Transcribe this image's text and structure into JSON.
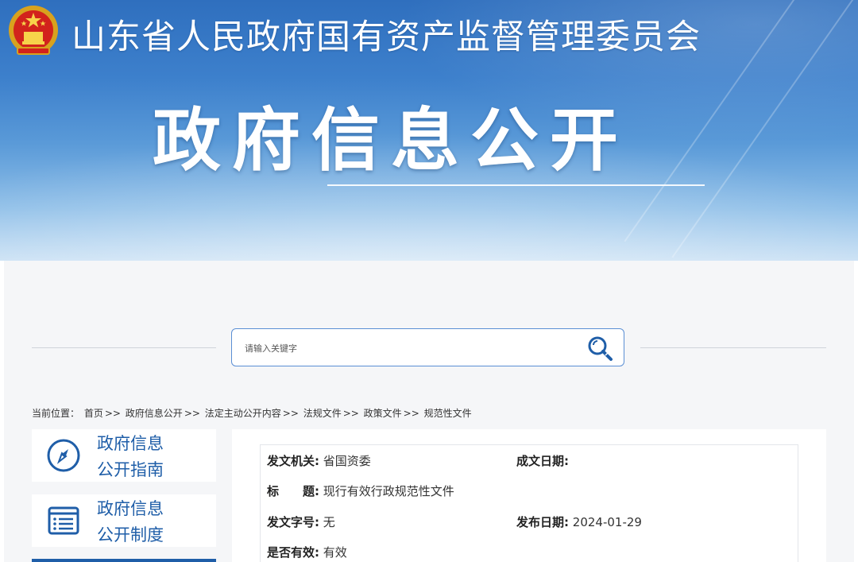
{
  "header": {
    "site_title": "山东省人民政府国有资产监督管理委员会",
    "page_heading": "政府信息公开"
  },
  "search": {
    "placeholder": "请输入关键字"
  },
  "breadcrumb": {
    "prefix": "当前位置：",
    "items": [
      "首页",
      "政府信息公开",
      "法定主动公开内容",
      "法规文件",
      "政策文件",
      "规范性文件"
    ],
    "separator": ">>"
  },
  "sidebar": {
    "items": [
      {
        "line1": "政府信息",
        "line2": "公开指南"
      },
      {
        "line1": "政府信息",
        "line2": "公开制度"
      }
    ]
  },
  "document_meta": {
    "issuer_label": "发文机关:",
    "issuer_value": "省国资委",
    "created_label": "成文日期:",
    "created_value": "",
    "title_label": "标　　题:",
    "title_value": "现行有效行政规范性文件",
    "doc_no_label": "发文字号:",
    "doc_no_value": "无",
    "published_label": "发布日期:",
    "published_value": "2024-01-29",
    "valid_label": "是否有效:",
    "valid_value": "有效"
  },
  "colors": {
    "accent": "#1f5ea8",
    "banner_top": "#2f6fbe",
    "search_border": "#5b8fd4"
  }
}
